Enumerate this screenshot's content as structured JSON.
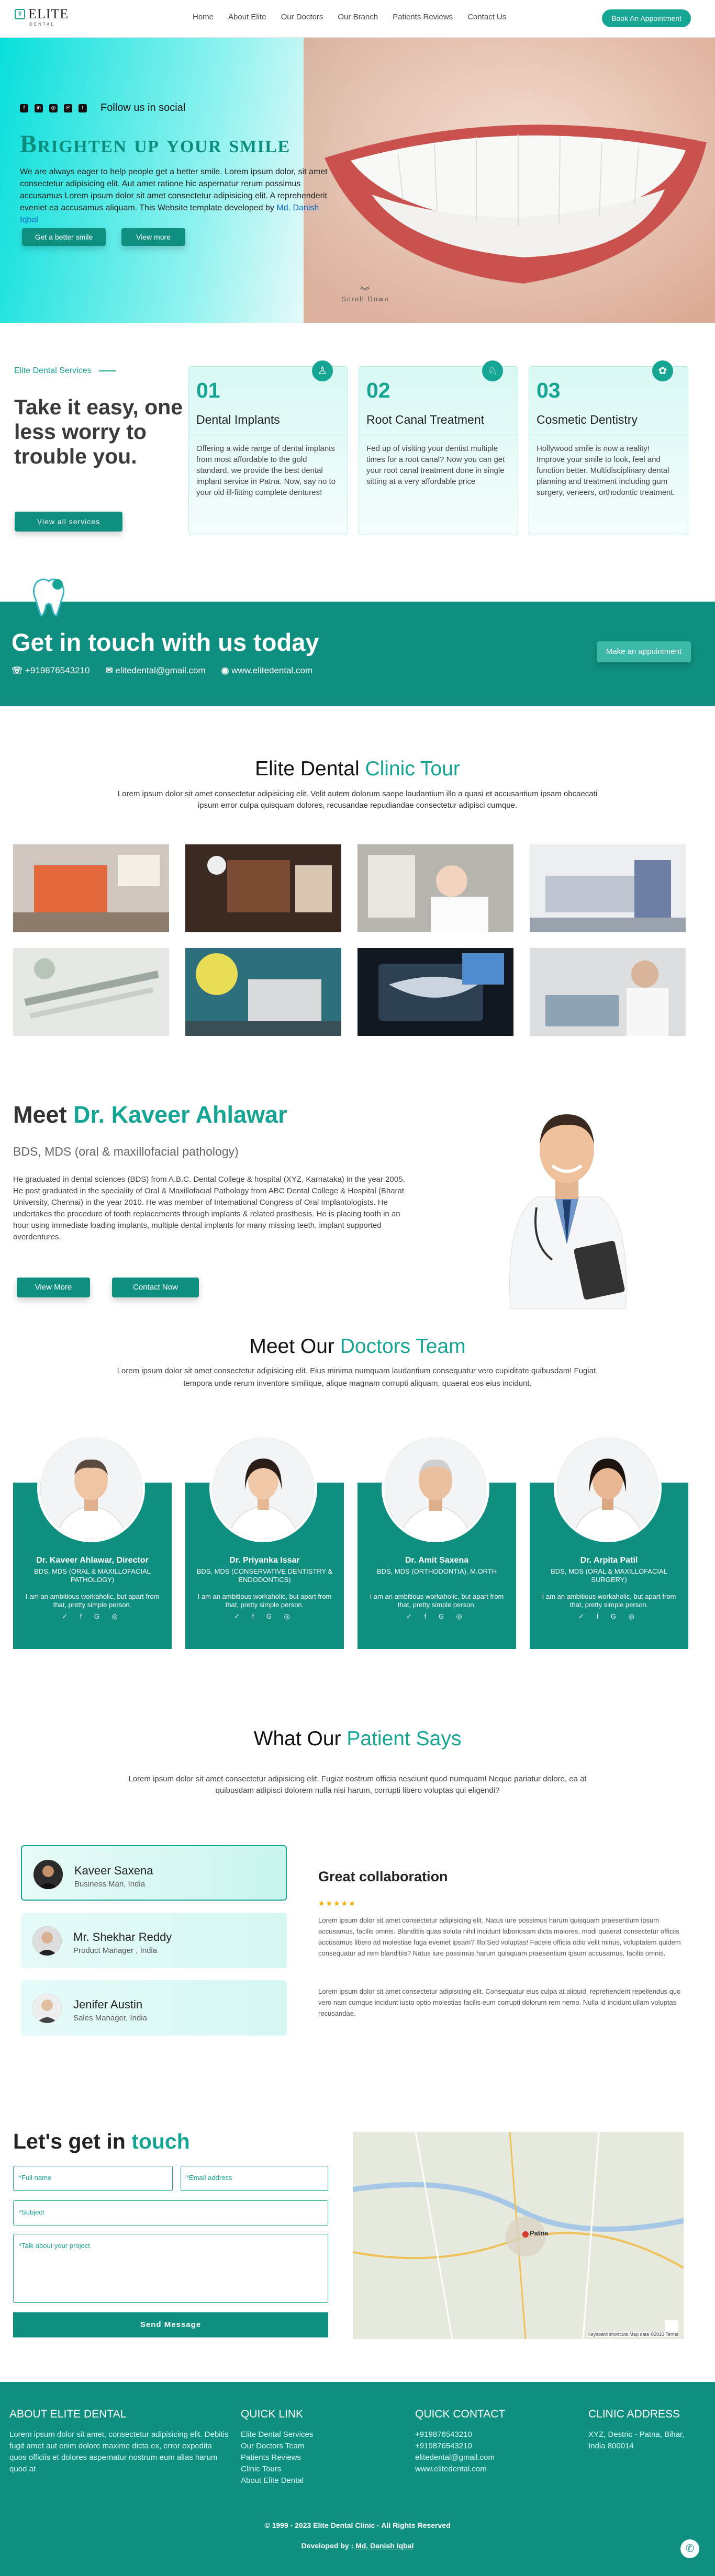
{
  "header": {
    "logo_mark": "☤",
    "logo_name": "ELITE",
    "logo_sub": "DENTAL",
    "nav": [
      "Home",
      "About Elite",
      "Our Doctors",
      "Our Branch",
      "Patients Reviews",
      "Contact Us"
    ],
    "book_btn": "Book An Appointment"
  },
  "hero": {
    "social_label": "Follow us in social",
    "social_icons": [
      "facebook-icon",
      "linkedin-icon",
      "instagram-icon",
      "pinterest-icon",
      "twitter-icon"
    ],
    "title": "Brighten up your smile",
    "text": "We are always eager to help people get a better smile. Lorem ipsum dolor, sit amet consectetur adipisicing elit. Aut amet ratione hic aspernatur rerum possimus accusamus Lorem ipsum dolor sit amet consectetur adipisicing elit. A reprehenderit eveniet ea accusamus aliquam. This Website template developed by",
    "dev_link": "Md. Danish Iqbal",
    "btn1": "Get a better smile",
    "btn2": "View more",
    "scroll": "Scroll Down"
  },
  "services": {
    "label": "Elite Dental Services",
    "heading": "Take it easy, one less worry to trouble you.",
    "btn": "View all services",
    "cards": [
      {
        "num": "01",
        "title": "Dental Implants",
        "desc": "Offering a wide range of dental implants from most affordable to the gold standard, we provide the best dental implant service in Patna. Now, say no to your old ill-fitting complete dentures!"
      },
      {
        "num": "02",
        "title": "Root Canal Treatment",
        "desc": "Fed up of visiting your dentist multiple times for a root canal? Now you can get your root canal treatment done in single sitting at a very affordable price"
      },
      {
        "num": "03",
        "title": "Cosmetic Dentistry",
        "desc": "Hollywood smile is now a reality! Improve your smile to look, feel and function better. Multidisciplinary dental planning and treatment including gum surgery, veneers, orthodontic treatment."
      }
    ]
  },
  "contact_band": {
    "title": "Get in touch with us today",
    "phone": "+919876543210",
    "email": "elitedental@gmail.com",
    "web": "www.elitedental.com",
    "btn": "Make an appointment"
  },
  "tour": {
    "title_a": "Elite Dental",
    "title_b": "Clinic Tour",
    "desc": "Lorem ipsum dolor sit amet consectetur adipisicing elit. Velit autem dolorum saepe laudantium illo a quasi et accusantium ipsam obcaecati ipsum error culpa quisquam dolores, recusandae repudiandae consectetur adipisci cumque."
  },
  "meet": {
    "title_a": "Meet",
    "title_b": "Dr. Kaveer Ahlawar",
    "subtitle": "BDS, MDS (oral & maxillofacial pathology)",
    "text": "He graduated in dental sciences (BDS) from A.B.C. Dental College & hospital (XYZ, Karnataka) in the year 2005. He post graduated in the speciality of Oral & Maxillofacial Pathology from ABC Dental College & Hospital (Bharat University, Chennai) in the year 2010. He was member of International Congress of Oral Implantologists. He undertakes the procedure of tooth replacements through implants & related prosthesis. He is placing tooth in an hour using immediate loading implants, multiple dental implants for many missing teeth, implant supported overdentures.",
    "btn1": "View More",
    "btn2": "Contact Now"
  },
  "team": {
    "title_a": "Meet Our",
    "title_b": "Doctors Team",
    "desc": "Lorem ipsum dolor sit amet consectetur adipisicing elit. Eius minima numquam laudantium consequatur vero cupiditate quibusdam! Fugiat, tempora unde rerum inventore similique, alique magnam corrupti aliquam, quaerat eos eius incidunt.",
    "doctors": [
      {
        "name": "Dr. Kaveer Ahlawar, Director",
        "deg": "BDS, MDS (ORAL & MAXILLOFACIAL PATHOLOGY)",
        "about": "I am an ambitious workaholic, but apart from that, pretty simple person."
      },
      {
        "name": "Dr. Priyanka Issar",
        "deg": "BDS, MDS (CONSERVATIVE DENTISTRY & ENDODONTICS)",
        "about": "I am an ambitious workaholic, but apart from that, pretty simple person."
      },
      {
        "name": "Dr. Amit Saxena",
        "deg": "BDS, MDS (ORTHODONTIA), M.ORTH",
        "about": "I am an ambitious workaholic, but apart from that, pretty simple person."
      },
      {
        "name": "Dr. Arpita Patil",
        "deg": "BDS, MDS (ORAL & MAXILLOFACIAL SURGERY)",
        "about": "I am an ambitious workaholic, but apart from that, pretty simple person."
      }
    ],
    "social_glyphs": "✓ f G ◎"
  },
  "testimonials": {
    "title_a": "What Our",
    "title_b": "Patient Says",
    "desc": "Lorem ipsum dolor sit amet consectetur adipisicing elit. Fugiat nostrum officia nesciunt quod numquam! Neque pariatur dolore, ea at quibusdam adipisci dolorem nulla nisi harum, corrupti libero voluptas qui eligendi?",
    "people": [
      {
        "name": "Kaveer Saxena",
        "role": "Business Man, India"
      },
      {
        "name": "Mr. Shekhar Reddy",
        "role": "Product Manager , India"
      },
      {
        "name": "Jenifer Austin",
        "role": "Sales Manager, India"
      }
    ],
    "quote_title": "Great collaboration",
    "stars": "★★★★★",
    "quote_p1": "Lorem ipsum dolor sit amet consectetur adipisicing elit. Natus iure possimus harum quisquam praesentium ipsum accusamus, facilis omnis. Blanditiis quas soluta nihil incidunt laboriosam dicta maiores, modi quaerat consectetur officiis accusamus libero ad molestiae fuga eveniet ipsam? Illo!Sed voluptas! Facere officia odio velit minus, voluptatem quidem consequatur ad rem blanditiis? Natus iure possimus harum quisquam praesentium ipsum accusamus, facilis omnis.",
    "quote_p2": "Lorem ipsum dolor sit amet consectetur adipisicing elit. Consequatur eius culpa at aliquid, reprehenderit repellendus quo vero nam cumque incidunt iusto optio molestias facilis eum corrupti dolorum rem nemo. Nulla id incidunt ullam voluptas recusandae."
  },
  "form": {
    "title_a": "Let's get in",
    "title_b": "touch",
    "full_name": "*Full name",
    "email": "*Email address",
    "subject": "*Subject",
    "project": "*Talk about your project",
    "send": "Send Message",
    "map_city": "Patna",
    "map_footer": "Keyboard shortcuts   Map data ©2023   Terms"
  },
  "footer": {
    "about_h": "ABOUT ELITE DENTAL",
    "about_p": "Lorem ipsum dolor sit amet, consectetur adipisicing elit. Debitis fugit amet aut enim dolore maxime dicta ex, error expedita quos officiis et dolores aspernatur nostrum eum alias harum quod at",
    "quick_h": "QUICK LINK",
    "quick": [
      "Elite Dental Services",
      "Our Doctors Team",
      "Patients Reviews",
      "Clinic Tours",
      "About Elite Dental"
    ],
    "contact_h": "QUICK CONTACT",
    "contact": [
      "+919876543210",
      "+919876543210",
      "elitedental@gmail.com",
      "www.elitedental.com"
    ],
    "address_h": "CLINIC ADDRESS",
    "address": "XYZ, Destric - Patna, Bihar, India 800014",
    "copy": "© 1999 - 2023 Elite Dental Clinic - All Rights Reserved",
    "dev": "Developed by :",
    "dev_name": "Md. Danish Iqbal"
  },
  "colors": {
    "accent": "#17a593",
    "dark_teal": "#0f8f7f"
  }
}
